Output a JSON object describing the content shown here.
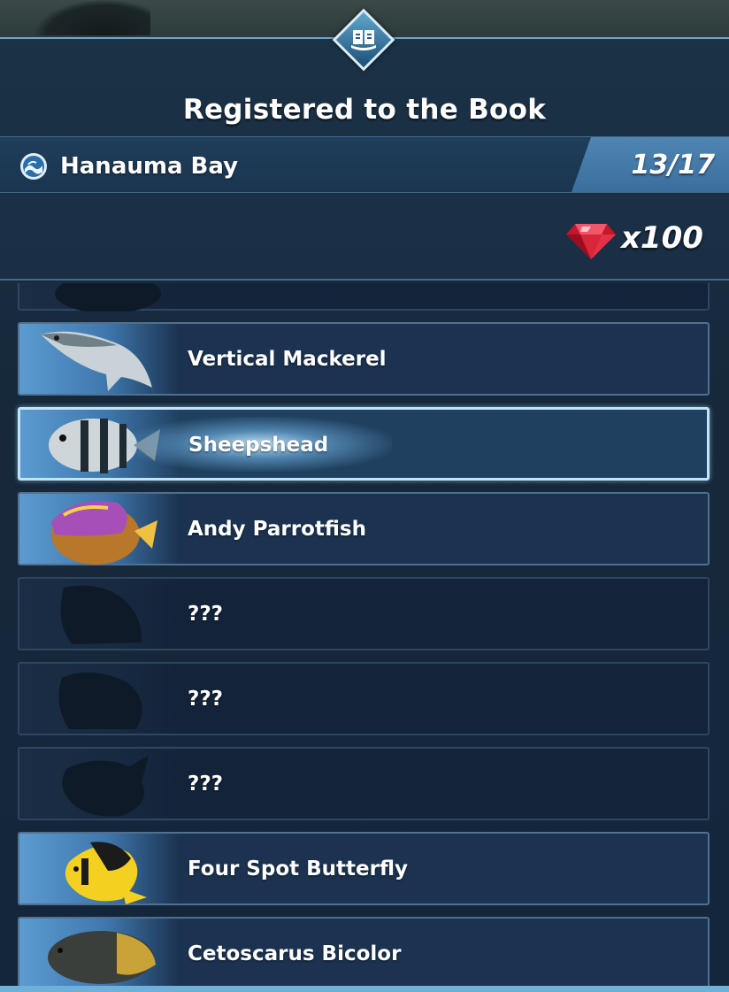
{
  "header": {
    "title": "Registered to the Book",
    "book_icon": "book-icon"
  },
  "location": {
    "icon": "water-drop-icon",
    "name": "Hanauma Bay",
    "progress": "13/17"
  },
  "reward": {
    "icon": "ruby-gem-icon",
    "amount": "x100"
  },
  "fish_list": [
    {
      "name": "",
      "state": "partial"
    },
    {
      "name": "Vertical Mackerel",
      "state": "registered"
    },
    {
      "name": "Sheepshead",
      "state": "selected"
    },
    {
      "name": "Andy Parrotfish",
      "state": "registered"
    },
    {
      "name": "???",
      "state": "unknown"
    },
    {
      "name": "???",
      "state": "unknown"
    },
    {
      "name": "???",
      "state": "unknown"
    },
    {
      "name": "Four Spot Butterfly",
      "state": "registered"
    },
    {
      "name": "Cetoscarus Bicolor",
      "state": "registered"
    }
  ],
  "colors": {
    "panel": "#1b3247",
    "accent": "#4f86b4",
    "gem": "#d8263a"
  }
}
